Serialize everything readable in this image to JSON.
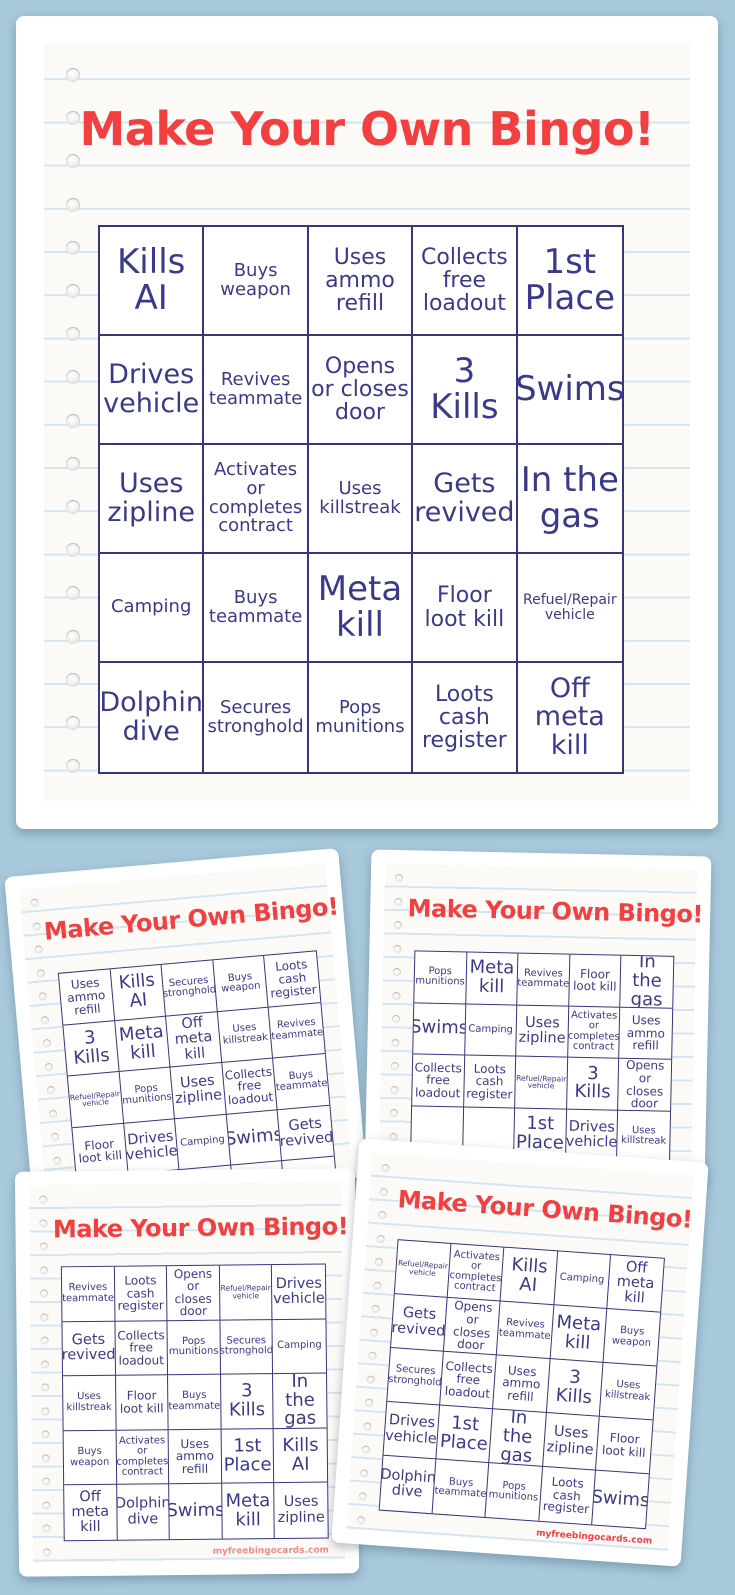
{
  "colors": {
    "background": "#a8c9dc",
    "title": "#f24040",
    "grid_line": "#36357f",
    "cell_text": "#3a3a8c",
    "paper_line": "#d3e6f2"
  },
  "main_card": {
    "title": "Make Your Own Bingo!",
    "cells": [
      [
        "Kills AI",
        "Buys weapon",
        "Uses ammo refill",
        "Collects free loadout",
        "1st Place"
      ],
      [
        "Drives vehicle",
        "Revives teammate",
        "Opens or closes door",
        "3 Kills",
        "Swims"
      ],
      [
        "Uses zipline",
        "Activates or completes contract",
        "Uses killstreak",
        "Gets revived",
        "In the gas"
      ],
      [
        "Camping",
        "Buys teammate",
        "Meta kill",
        "Floor loot kill",
        "Refuel/Repair vehicle"
      ],
      [
        "Dolphin dive",
        "Secures stronghold",
        "Pops munitions",
        "Loots cash register",
        "Off meta kill"
      ]
    ]
  },
  "preview_cards": [
    {
      "title": "Make Your Own Bingo!",
      "cells": [
        [
          "Uses ammo refill",
          "Kills AI",
          "Secures stronghold",
          "Buys weapon",
          "Loots cash register"
        ],
        [
          "3 Kills",
          "Meta kill",
          "Off meta kill",
          "Uses killstreak",
          "Revives teammate"
        ],
        [
          "Refuel/Repair vehicle",
          "Pops munitions",
          "Uses zipline",
          "Collects free loadout",
          "Buys teammate"
        ],
        [
          "Floor loot kill",
          "Drives vehicle",
          "Camping",
          "Swims",
          "Gets revived"
        ],
        [
          "",
          "",
          "",
          "",
          ""
        ]
      ]
    },
    {
      "title": "Make Your Own Bingo!",
      "cells": [
        [
          "Pops munitions",
          "Meta kill",
          "Revives teammate",
          "Floor loot kill",
          "In the gas"
        ],
        [
          "Swims",
          "Camping",
          "Uses zipline",
          "Activates or completes contract",
          "Uses ammo refill"
        ],
        [
          "Collects free loadout",
          "Loots cash register",
          "Refuel/Repair vehicle",
          "3 Kills",
          "Opens or closes door"
        ],
        [
          "",
          "",
          "1st Place",
          "Drives vehicle",
          "Uses killstreak"
        ],
        [
          "",
          "",
          "",
          "",
          ""
        ]
      ]
    },
    {
      "title": "Make Your Own Bingo!",
      "watermark": "myfreebingocards.com",
      "cells": [
        [
          "Revives teammate",
          "Loots cash register",
          "Opens or closes door",
          "Refuel/Repair vehicle",
          "Drives vehicle"
        ],
        [
          "Gets revived",
          "Collects free loadout",
          "Pops munitions",
          "Secures stronghold",
          "Camping"
        ],
        [
          "Uses killstreak",
          "Floor loot kill",
          "Buys teammate",
          "3 Kills",
          "In the gas"
        ],
        [
          "Buys weapon",
          "Activates or completes contract",
          "Uses ammo refill",
          "1st Place",
          "Kills AI"
        ],
        [
          "Off meta kill",
          "Dolphin dive",
          "Swims",
          "Meta kill",
          "Uses zipline"
        ]
      ]
    },
    {
      "title": "Make Your Own Bingo!",
      "watermark": "myfreebingocards.com",
      "cells": [
        [
          "Refuel/Repair vehicle",
          "Activates or completes contract",
          "Kills AI",
          "Camping",
          "Off meta kill"
        ],
        [
          "Gets revived",
          "Opens or closes door",
          "Revives teammate",
          "Meta kill",
          "Buys weapon"
        ],
        [
          "Secures stronghold",
          "Collects free loadout",
          "Uses ammo refill",
          "3 Kills",
          "Uses killstreak"
        ],
        [
          "Drives vehicle",
          "1st Place",
          "In the gas",
          "Uses zipline",
          "Floor loot kill"
        ],
        [
          "Dolphin dive",
          "Buys teammate",
          "Pops munitions",
          "Loots cash register",
          "Swims"
        ]
      ]
    }
  ]
}
